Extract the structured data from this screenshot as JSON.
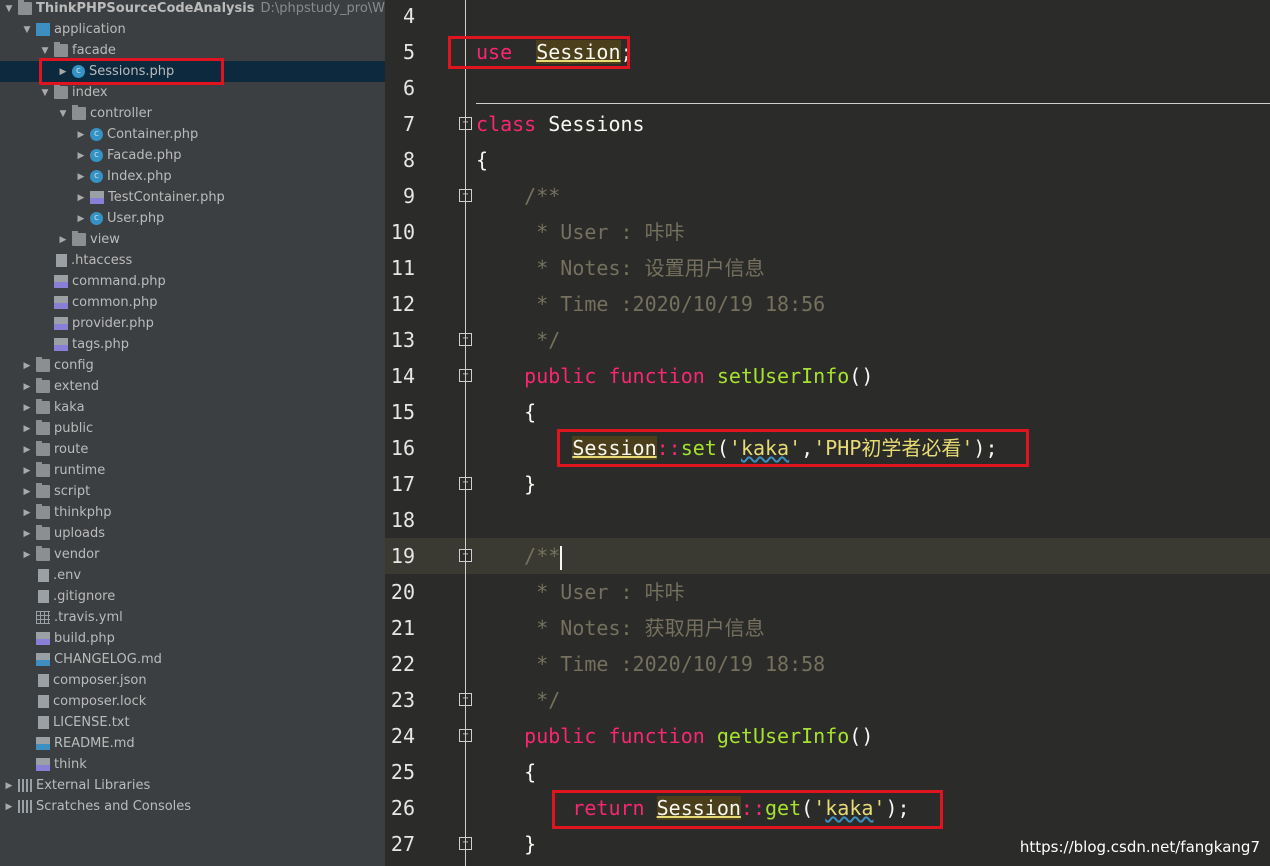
{
  "project": {
    "name": "ThinkPHPSourceCodeAnalysis",
    "path": "D:\\phpstudy_pro\\WWW\\Th"
  },
  "tree": [
    {
      "d": 1,
      "a": "open",
      "i": "folder-blue",
      "label": "application"
    },
    {
      "d": 2,
      "a": "open",
      "i": "folder",
      "label": "facade"
    },
    {
      "d": 3,
      "a": "closed",
      "i": "class",
      "label": "Sessions.php",
      "selected": true
    },
    {
      "d": 2,
      "a": "open",
      "i": "folder",
      "label": "index"
    },
    {
      "d": 3,
      "a": "open",
      "i": "folder",
      "label": "controller"
    },
    {
      "d": 4,
      "a": "closed",
      "i": "class",
      "label": "Container.php"
    },
    {
      "d": 4,
      "a": "closed",
      "i": "class",
      "label": "Facade.php"
    },
    {
      "d": 4,
      "a": "closed",
      "i": "class",
      "label": "Index.php"
    },
    {
      "d": 4,
      "a": "closed",
      "i": "php",
      "label": "TestContainer.php"
    },
    {
      "d": 4,
      "a": "closed",
      "i": "class",
      "label": "User.php"
    },
    {
      "d": 3,
      "a": "closed",
      "i": "folder",
      "label": "view"
    },
    {
      "d": 2,
      "a": "none",
      "i": "file",
      "label": ".htaccess"
    },
    {
      "d": 2,
      "a": "none",
      "i": "php",
      "label": "command.php"
    },
    {
      "d": 2,
      "a": "none",
      "i": "php",
      "label": "common.php"
    },
    {
      "d": 2,
      "a": "none",
      "i": "php",
      "label": "provider.php"
    },
    {
      "d": 2,
      "a": "none",
      "i": "php",
      "label": "tags.php"
    },
    {
      "d": 1,
      "a": "closed",
      "i": "folder",
      "label": "config"
    },
    {
      "d": 1,
      "a": "closed",
      "i": "folder",
      "label": "extend"
    },
    {
      "d": 1,
      "a": "closed",
      "i": "folder",
      "label": "kaka"
    },
    {
      "d": 1,
      "a": "closed",
      "i": "folder",
      "label": "public"
    },
    {
      "d": 1,
      "a": "closed",
      "i": "folder",
      "label": "route"
    },
    {
      "d": 1,
      "a": "closed",
      "i": "folder",
      "label": "runtime"
    },
    {
      "d": 1,
      "a": "closed",
      "i": "folder",
      "label": "script"
    },
    {
      "d": 1,
      "a": "closed",
      "i": "folder",
      "label": "thinkphp"
    },
    {
      "d": 1,
      "a": "closed",
      "i": "folder",
      "label": "uploads"
    },
    {
      "d": 1,
      "a": "closed",
      "i": "folder",
      "label": "vendor"
    },
    {
      "d": 1,
      "a": "none",
      "i": "file",
      "label": ".env"
    },
    {
      "d": 1,
      "a": "none",
      "i": "file",
      "label": ".gitignore"
    },
    {
      "d": 1,
      "a": "none",
      "i": "grid",
      "label": ".travis.yml"
    },
    {
      "d": 1,
      "a": "none",
      "i": "php",
      "label": "build.php"
    },
    {
      "d": 1,
      "a": "none",
      "i": "md",
      "label": "CHANGELOG.md"
    },
    {
      "d": 1,
      "a": "none",
      "i": "file",
      "label": "composer.json"
    },
    {
      "d": 1,
      "a": "none",
      "i": "file",
      "label": "composer.lock"
    },
    {
      "d": 1,
      "a": "none",
      "i": "file",
      "label": "LICENSE.txt"
    },
    {
      "d": 1,
      "a": "none",
      "i": "md",
      "label": "README.md"
    },
    {
      "d": 1,
      "a": "none",
      "i": "php",
      "label": "think"
    },
    {
      "d": 0,
      "a": "closed",
      "i": "lib",
      "label": "External Libraries"
    },
    {
      "d": 0,
      "a": "closed",
      "i": "lib",
      "label": "Scratches and Consoles"
    }
  ],
  "code": [
    {
      "n": "4",
      "t": []
    },
    {
      "n": "5",
      "t": [
        [
          "kw",
          "use"
        ],
        [
          "",
          "  "
        ],
        [
          "hl",
          "Session"
        ],
        [
          "",
          ";"
        ]
      ]
    },
    {
      "n": "6",
      "t": []
    },
    {
      "n": "7",
      "fold": "open",
      "t": [
        [
          "kw",
          "class"
        ],
        [
          "",
          " Sessions"
        ]
      ]
    },
    {
      "n": "8",
      "t": [
        [
          "",
          "{"
        ]
      ]
    },
    {
      "n": "9",
      "fold": "open",
      "t": [
        [
          "cm",
          "    /**"
        ]
      ]
    },
    {
      "n": "10",
      "t": [
        [
          "cm",
          "     * User : 咔咔"
        ]
      ]
    },
    {
      "n": "11",
      "t": [
        [
          "cm",
          "     * Notes: 设置用户信息"
        ]
      ]
    },
    {
      "n": "12",
      "t": [
        [
          "cm",
          "     * Time :2020/10/19 18:56"
        ]
      ]
    },
    {
      "n": "13",
      "fold": "close",
      "t": [
        [
          "cm",
          "     */"
        ]
      ]
    },
    {
      "n": "14",
      "fold": "open",
      "t": [
        [
          "",
          "    "
        ],
        [
          "kw",
          "public"
        ],
        [
          "",
          " "
        ],
        [
          "kw",
          "function"
        ],
        [
          "",
          " "
        ],
        [
          "fn",
          "setUserInfo"
        ],
        [
          "",
          "()"
        ]
      ]
    },
    {
      "n": "15",
      "t": [
        [
          "",
          "    {"
        ]
      ]
    },
    {
      "n": "16",
      "t": [
        [
          "",
          "        "
        ],
        [
          "hl",
          "Session"
        ],
        [
          "op",
          "::"
        ],
        [
          "fn",
          "set"
        ],
        [
          "",
          "("
        ],
        [
          "str",
          "'"
        ],
        [
          "str squig",
          "kaka"
        ],
        [
          "str",
          "'"
        ],
        [
          "",
          ","
        ],
        [
          "str",
          "'PHP初学者必看'"
        ],
        [
          "",
          ");"
        ]
      ]
    },
    {
      "n": "17",
      "fold": "close",
      "t": [
        [
          "",
          "    }"
        ]
      ]
    },
    {
      "n": "18",
      "t": []
    },
    {
      "n": "19",
      "fold": "open",
      "cur": true,
      "t": [
        [
          "cm",
          "    /**"
        ]
      ]
    },
    {
      "n": "20",
      "t": [
        [
          "cm",
          "     * User : 咔咔"
        ]
      ]
    },
    {
      "n": "21",
      "t": [
        [
          "cm",
          "     * Notes: 获取用户信息"
        ]
      ]
    },
    {
      "n": "22",
      "t": [
        [
          "cm",
          "     * Time :2020/10/19 18:58"
        ]
      ]
    },
    {
      "n": "23",
      "fold": "close",
      "t": [
        [
          "cm",
          "     */"
        ]
      ]
    },
    {
      "n": "24",
      "fold": "open",
      "t": [
        [
          "",
          "    "
        ],
        [
          "kw",
          "public"
        ],
        [
          "",
          " "
        ],
        [
          "kw",
          "function"
        ],
        [
          "",
          " "
        ],
        [
          "fn",
          "getUserInfo"
        ],
        [
          "",
          "()"
        ]
      ]
    },
    {
      "n": "25",
      "t": [
        [
          "",
          "    {"
        ]
      ]
    },
    {
      "n": "26",
      "t": [
        [
          "",
          "        "
        ],
        [
          "kw",
          "return"
        ],
        [
          "",
          " "
        ],
        [
          "hl",
          "Session"
        ],
        [
          "op",
          "::"
        ],
        [
          "fn",
          "get"
        ],
        [
          "",
          "("
        ],
        [
          "str",
          "'"
        ],
        [
          "str squig",
          "kaka"
        ],
        [
          "str",
          "'"
        ],
        [
          "",
          ");"
        ]
      ]
    },
    {
      "n": "27",
      "fold": "close",
      "t": [
        [
          "",
          "    }"
        ]
      ]
    }
  ],
  "watermark": "https://blog.csdn.net/fangkang7",
  "colors": {
    "keyword": "#f92672",
    "function": "#a6e22e",
    "string": "#e6db74",
    "comment": "#75715e",
    "highlight_box": "#e0141e"
  }
}
